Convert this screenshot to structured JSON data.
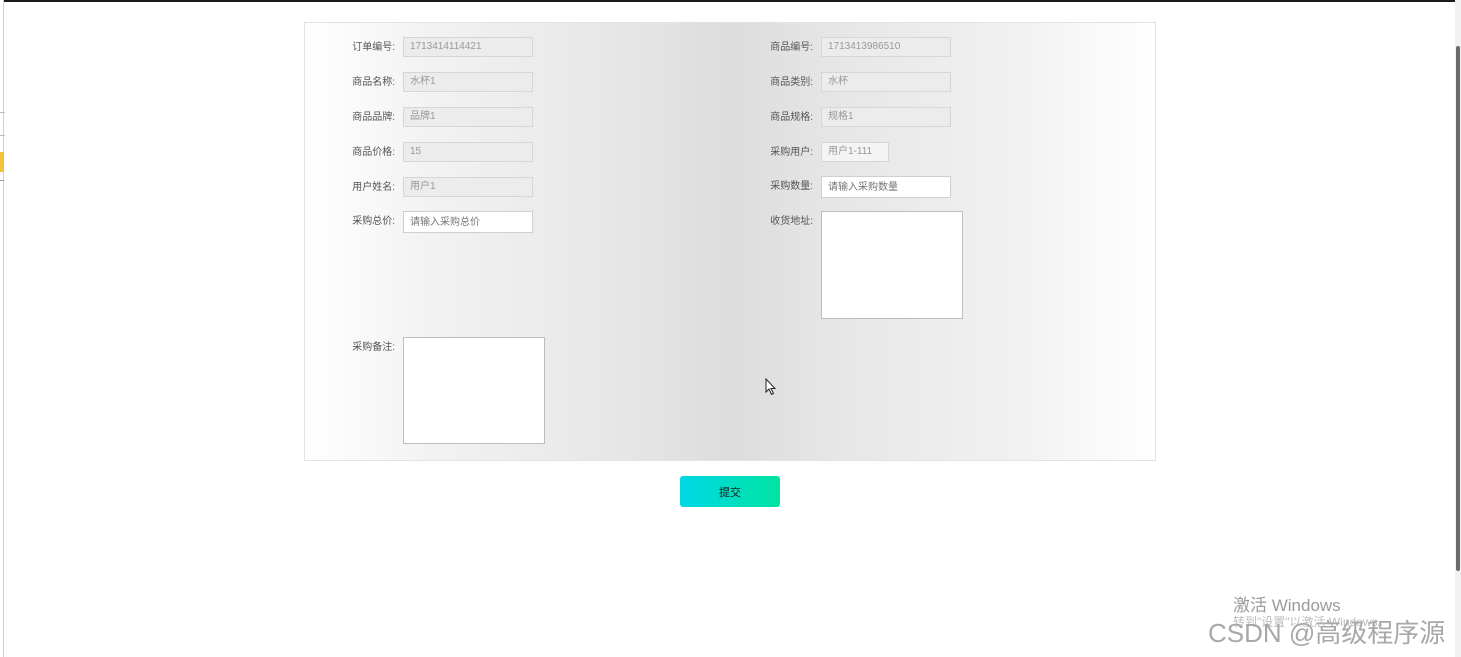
{
  "form": {
    "left": [
      {
        "label": "订单编号:",
        "value": "1713414114421",
        "placeholder": "",
        "editable": false
      },
      {
        "label": "商品名称:",
        "value": "水杯1",
        "placeholder": "",
        "editable": false
      },
      {
        "label": "商品品牌:",
        "value": "品牌1",
        "placeholder": "",
        "editable": false
      },
      {
        "label": "商品价格:",
        "value": "15",
        "placeholder": "",
        "editable": false
      },
      {
        "label": "用户姓名:",
        "value": "用户1",
        "placeholder": "",
        "editable": false
      },
      {
        "label": "采购总价:",
        "value": "",
        "placeholder": "请输入采购总价",
        "editable": true
      }
    ],
    "right": [
      {
        "label": "商品编号:",
        "value": "1713413986510",
        "placeholder": "",
        "editable": false
      },
      {
        "label": "商品类别:",
        "value": "水杯",
        "placeholder": "",
        "editable": false
      },
      {
        "label": "商品规格:",
        "value": "规格1",
        "placeholder": "",
        "editable": false
      },
      {
        "label": "采购用户:",
        "value": "用户1-111",
        "placeholder": "",
        "editable": false
      },
      {
        "label": "采购数量:",
        "value": "",
        "placeholder": "请输入采购数量",
        "editable": true
      }
    ],
    "address_label": "收货地址:",
    "address_value": "",
    "remark_label": "采购备注:",
    "remark_value": ""
  },
  "submit_label": "提交",
  "watermark": {
    "activate": "激活 Windows",
    "activate_sub": "转到\"设置\"以激活 Windows。",
    "csdn": "CSDN @高级程序源"
  },
  "colors": {
    "accent_start": "#00d8e8",
    "accent_end": "#00e3a0"
  }
}
